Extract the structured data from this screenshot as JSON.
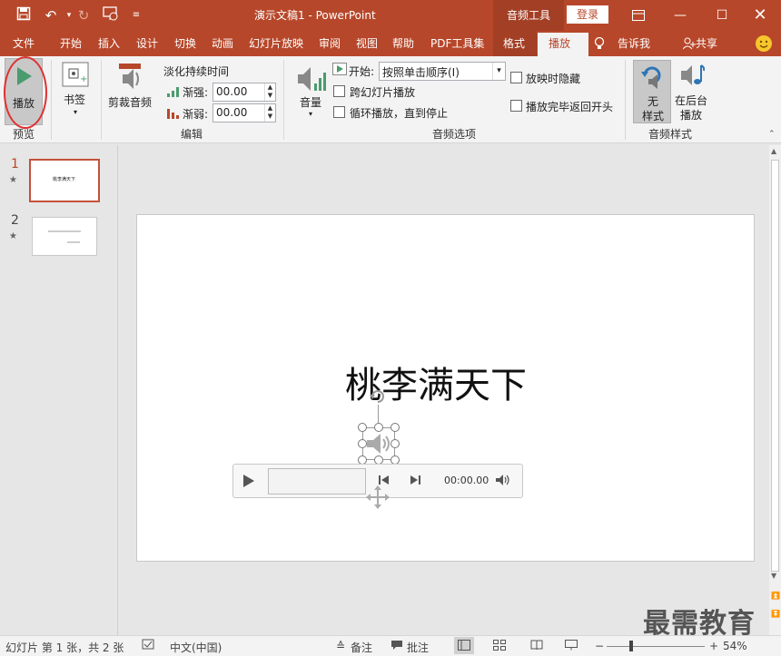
{
  "window": {
    "title": "演示文稿1 - PowerPoint",
    "context_tab": "音频工具",
    "login": "登录"
  },
  "menu": {
    "tabs": [
      "文件",
      "开始",
      "插入",
      "设计",
      "切换",
      "动画",
      "幻灯片放映",
      "审阅",
      "视图",
      "帮助",
      "PDF工具集",
      "格式",
      "播放"
    ],
    "tell_me": "告诉我",
    "share": "共享"
  },
  "ribbon": {
    "play_label": "播放",
    "preview_group": "预览",
    "bookmark_label": "书签",
    "trim_label": "剪裁音频",
    "fade_title": "淡化持续时间",
    "fade_in_label": "渐强:",
    "fade_in_value": "00.00",
    "fade_out_label": "渐弱:",
    "fade_out_value": "00.00",
    "edit_group": "编辑",
    "volume_label": "音量",
    "start_label": "开始:",
    "start_value": "按照单击顺序(I)",
    "cross_slides": "跨幻灯片播放",
    "loop": "循环播放，直到停止",
    "hide_during_show": "放映时隐藏",
    "rewind": "播放完毕返回开头",
    "audio_options_group": "音频选项",
    "no_style": [
      "无",
      "样式"
    ],
    "bg_play": [
      "在后台",
      "播放"
    ],
    "audio_styles_group": "音频样式"
  },
  "slides": {
    "items": [
      {
        "number": "1",
        "marker": "★",
        "thumb_text": "桃李满天下"
      },
      {
        "number": "2",
        "marker": "★",
        "thumb_text": ""
      }
    ]
  },
  "slide": {
    "title": "桃李满天下",
    "player_time": "00:00.00"
  },
  "status": {
    "slide_info": "幻灯片 第 1 张，共 2 张",
    "language": "中文(中国)",
    "notes": "备注",
    "comments": "批注",
    "zoom": "54%"
  },
  "watermark": "最需教育",
  "colors": {
    "accent": "#b7472a",
    "play_green": "#4a9b6e",
    "highlight_red": "#e03030"
  }
}
